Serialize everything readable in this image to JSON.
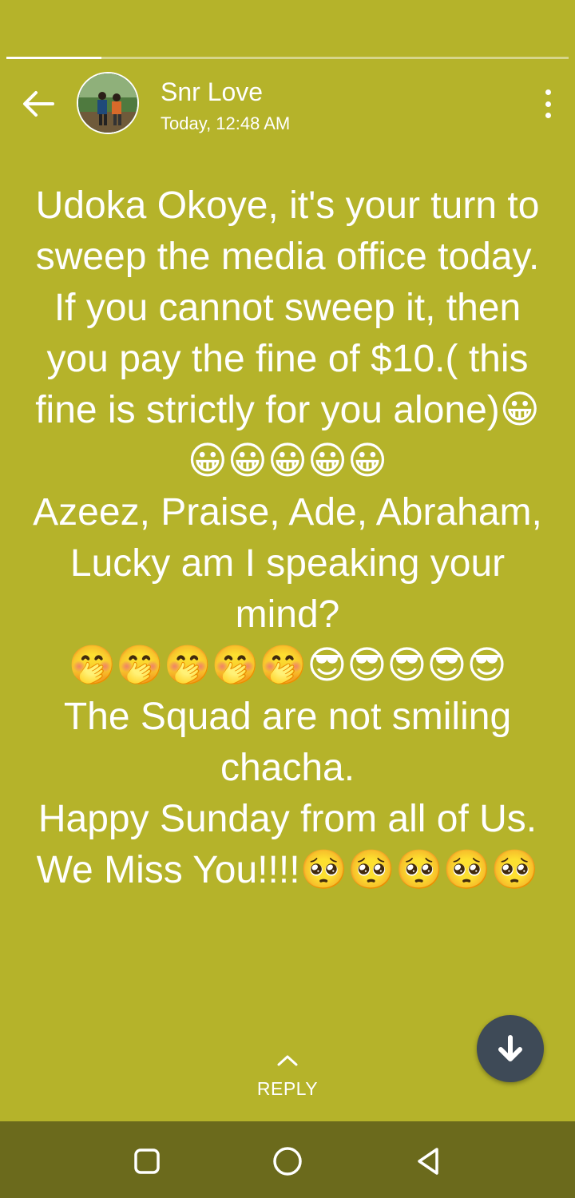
{
  "status": {
    "progress": 0.169,
    "sender_name": "Snr Love",
    "timestamp": "Today, 12:48 AM",
    "message": "Udoka Okoye, it's your turn to sweep the media office today. If you cannot sweep it, then you pay the fine of $10.( this fine is strictly for you alone)😀😀😀😀😀😀\nAzeez, Praise, Ade, Abraham, Lucky am I speaking your mind?\n🤭🤭🤭🤭🤭😎😎😎😎😎\nThe Squad are not smiling chacha.\nHappy Sunday from all of Us.\nWe Miss You!!!!🥺🥺🥺🥺🥺",
    "background_color": "#b5b32a"
  },
  "reply": {
    "label": "REPLY"
  },
  "icons": {
    "back": "arrow-left-icon",
    "more": "more-vertical-icon",
    "reply": "chevron-up-icon",
    "scroll_down": "arrow-down-icon",
    "nav_recents": "square-icon",
    "nav_home": "circle-icon",
    "nav_back": "triangle-back-icon"
  },
  "colors": {
    "accent_button": "#3e4a57",
    "nav_bar": "#6b6a1c"
  }
}
